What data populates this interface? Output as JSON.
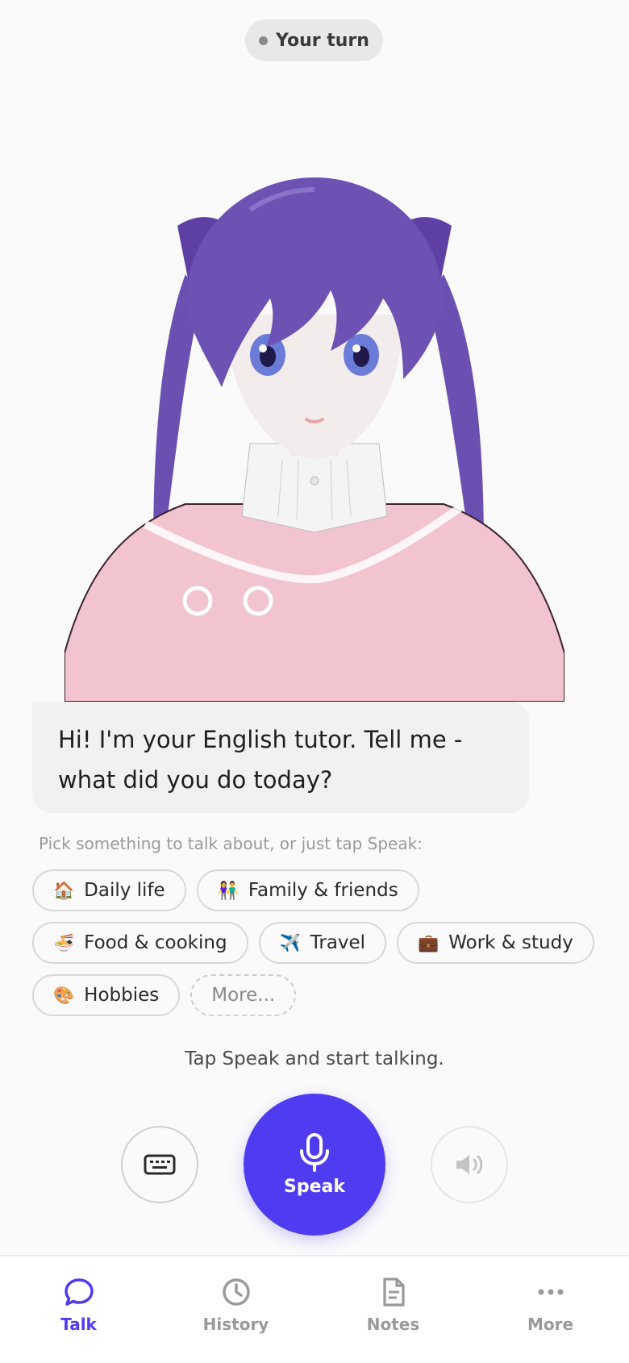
{
  "status": {
    "label": "Your turn"
  },
  "tutor_message": "Hi! I'm your English tutor. Tell me - what did you do today?",
  "topic_prompt": "Pick something to talk about, or just tap Speak:",
  "topics": [
    {
      "icon": "🏠",
      "icon_name": "house-icon",
      "label": "Daily life"
    },
    {
      "icon": "👫",
      "icon_name": "people-icon",
      "label": "Family & friends"
    },
    {
      "icon": "🍜",
      "icon_name": "noodle-bowl-icon",
      "label": "Food & cooking"
    },
    {
      "icon": "✈️",
      "icon_name": "airplane-icon",
      "label": "Travel"
    },
    {
      "icon": "💼",
      "icon_name": "briefcase-icon",
      "label": "Work & study"
    },
    {
      "icon": "🎨",
      "icon_name": "palette-icon",
      "label": "Hobbies"
    }
  ],
  "more_chip": "More...",
  "hint": "Tap Speak and start talking.",
  "controls": {
    "speak_label": "Speak"
  },
  "nav": {
    "items": [
      {
        "label": "Talk",
        "icon_name": "chat-bubble-icon",
        "active": true
      },
      {
        "label": "History",
        "icon_name": "clock-icon",
        "active": false
      },
      {
        "label": "Notes",
        "icon_name": "document-icon",
        "active": false
      },
      {
        "label": "More",
        "icon_name": "more-dots-icon",
        "active": false
      }
    ]
  },
  "colors": {
    "accent": "#4f3bf0",
    "hair": "#6a4fb0",
    "outfit": "#f2c4cf"
  }
}
